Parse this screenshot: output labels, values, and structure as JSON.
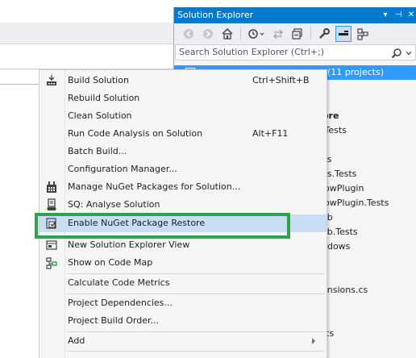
{
  "solution_explorer": {
    "title": "Solution Explorer",
    "search_placeholder": "Search Solution Explorer (Ctrl+;)",
    "selected_suffix": "(11 projects)",
    "visible_fragments": [
      "ore",
      ".Tests",
      "es",
      "es.Tests",
      "lowPlugin",
      "lowPlugin.Tests",
      "eb",
      "eb.Tests",
      "ndows",
      "ensions.cs",
      "s",
      ".cs"
    ]
  },
  "context_menu": {
    "items": [
      {
        "label": "Build Solution",
        "shortcut": "Ctrl+Shift+B",
        "icon": "build-solution-icon"
      },
      {
        "label": "Rebuild Solution",
        "shortcut": "",
        "icon": ""
      },
      {
        "label": "Clean Solution",
        "shortcut": "",
        "icon": ""
      },
      {
        "label": "Run Code Analysis on Solution",
        "shortcut": "Alt+F11",
        "icon": ""
      },
      {
        "label": "Batch Build...",
        "shortcut": "",
        "icon": ""
      },
      {
        "label": "Configuration Manager...",
        "shortcut": "",
        "icon": ""
      },
      {
        "label": "Manage NuGet Packages for Solution...",
        "shortcut": "",
        "icon": "nuget-icon"
      },
      {
        "label": "SQ: Analyse Solution",
        "shortcut": "",
        "icon": "sonarqube-icon"
      },
      {
        "label": "Enable NuGet Package Restore",
        "shortcut": "",
        "icon": "package-restore-icon"
      },
      {
        "label": "New Solution Explorer View",
        "shortcut": "",
        "icon": "new-view-icon"
      },
      {
        "label": "Show on Code Map",
        "shortcut": "",
        "icon": "code-map-icon"
      },
      {
        "label": "Calculate Code Metrics",
        "shortcut": "",
        "icon": ""
      },
      {
        "label": "Project Dependencies...",
        "shortcut": "",
        "icon": ""
      },
      {
        "label": "Project Build Order...",
        "shortcut": "",
        "icon": ""
      },
      {
        "label": "Add",
        "shortcut": "",
        "icon": ""
      }
    ],
    "hovered_item": "Enable NuGet Package Restore"
  },
  "colors": {
    "title_bar": "#007acc",
    "selection": "#3399ff",
    "hover": "#c9def5",
    "annotation_box": "#29a64a"
  }
}
